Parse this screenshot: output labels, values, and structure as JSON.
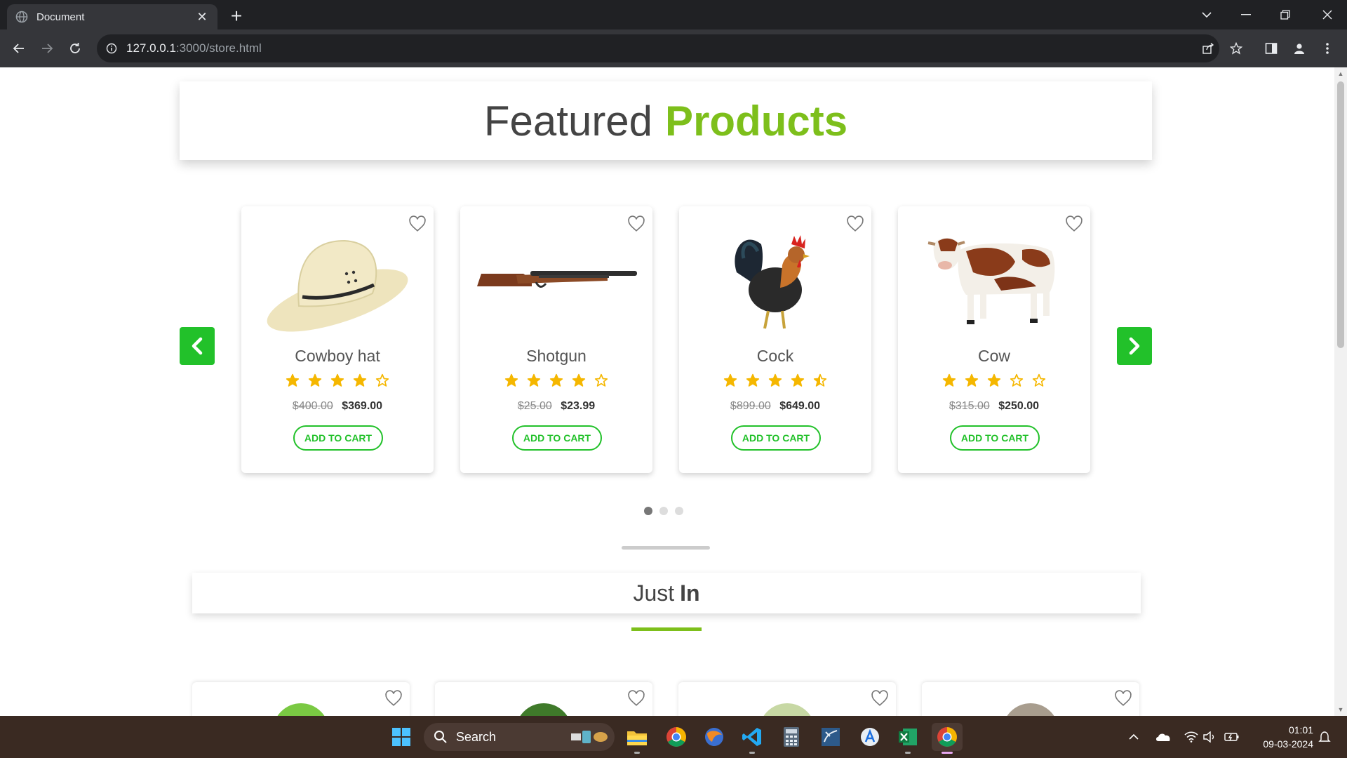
{
  "browser": {
    "tab_title": "Document",
    "url_host": "127.0.0.1",
    "url_path": ":3000/store.html"
  },
  "page": {
    "featured_title_plain": "Featured",
    "featured_title_accent": "Products",
    "products": [
      {
        "name": "Cowboy hat",
        "old_price": "$400.00",
        "new_price": "$369.00",
        "rating": 4,
        "image": "cowboy-hat"
      },
      {
        "name": "Shotgun",
        "old_price": "$25.00",
        "new_price": "$23.99",
        "rating": 4,
        "image": "shotgun"
      },
      {
        "name": "Cock",
        "old_price": "$899.00",
        "new_price": "$649.00",
        "rating": 4.5,
        "image": "rooster"
      },
      {
        "name": "Cow",
        "old_price": "$315.00",
        "new_price": "$250.00",
        "rating": 3,
        "image": "cow"
      }
    ],
    "add_to_cart_label": "ADD TO CART",
    "carousel_pages": 3,
    "carousel_active_page": 1,
    "just_in_plain": "Just",
    "just_in_bold": "In",
    "accent_color": "#7dbf1b",
    "button_color": "#22c12a",
    "star_color": "#f5b700"
  },
  "taskbar": {
    "search_label": "Search",
    "time": "01:01",
    "date": "09-03-2024"
  }
}
